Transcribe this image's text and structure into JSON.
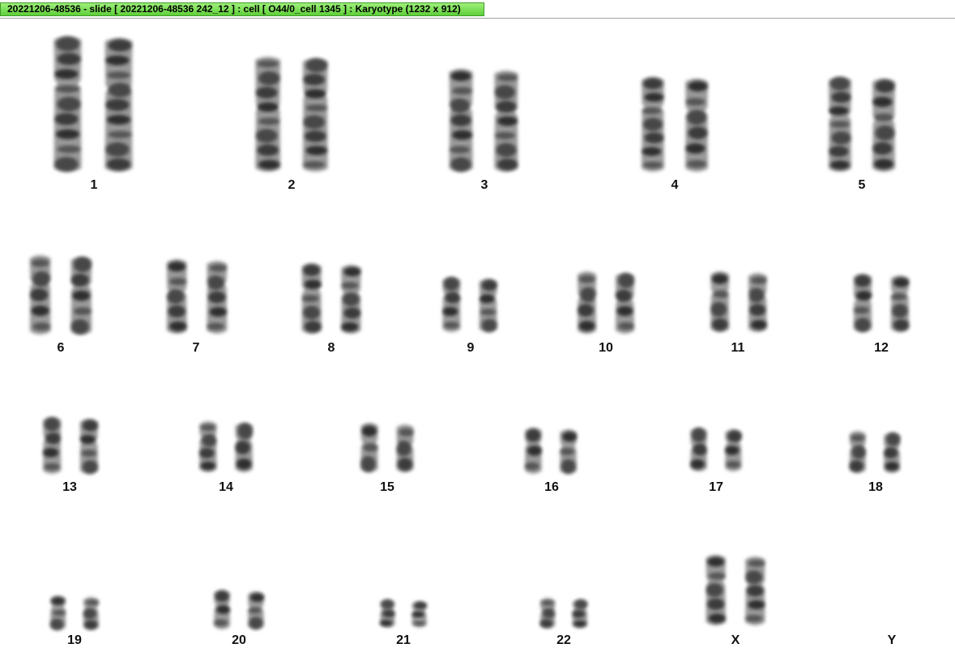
{
  "window": {
    "title": "20221206-48536 - slide [ 20221206-48536 242_12 ] : cell [ O44/0_cell 1345 ] : Karyotype  (1232 x 912)"
  },
  "karyotype": {
    "chromosomes": [
      {
        "label": "1"
      },
      {
        "label": "2"
      },
      {
        "label": "3"
      },
      {
        "label": "4"
      },
      {
        "label": "5"
      },
      {
        "label": "6"
      },
      {
        "label": "7"
      },
      {
        "label": "8"
      },
      {
        "label": "9"
      },
      {
        "label": "10"
      },
      {
        "label": "11"
      },
      {
        "label": "12"
      },
      {
        "label": "13"
      },
      {
        "label": "14"
      },
      {
        "label": "15"
      },
      {
        "label": "16"
      },
      {
        "label": "17"
      },
      {
        "label": "18"
      },
      {
        "label": "19"
      },
      {
        "label": "20"
      },
      {
        "label": "21"
      },
      {
        "label": "22"
      },
      {
        "label": "X"
      },
      {
        "label": "Y"
      }
    ]
  },
  "colors": {
    "title_tab": "#7ee05a",
    "chromatin": "#1a1a1a"
  }
}
